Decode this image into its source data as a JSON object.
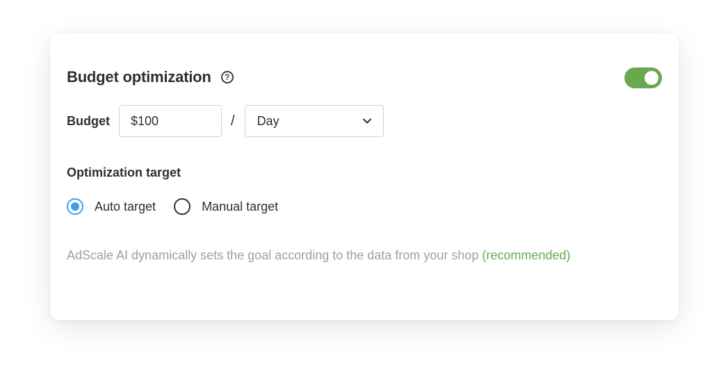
{
  "section": {
    "title": "Budget optimization",
    "help_icon": "question-circle-icon",
    "enabled": true
  },
  "budget": {
    "label": "Budget",
    "amount": "$100",
    "separator": "/",
    "period": "Day",
    "period_icon": "chevron-down-icon"
  },
  "optimization": {
    "heading": "Optimization target",
    "options": [
      {
        "label": "Auto target",
        "selected": true
      },
      {
        "label": "Manual target",
        "selected": false
      }
    ],
    "description": "AdScale AI dynamically sets the goal according to the data from your shop",
    "recommended": "(recommended)"
  },
  "colors": {
    "accent_green": "#6aa84f",
    "radio_blue": "#3aa0e8",
    "muted_text": "#9aa0a6"
  }
}
